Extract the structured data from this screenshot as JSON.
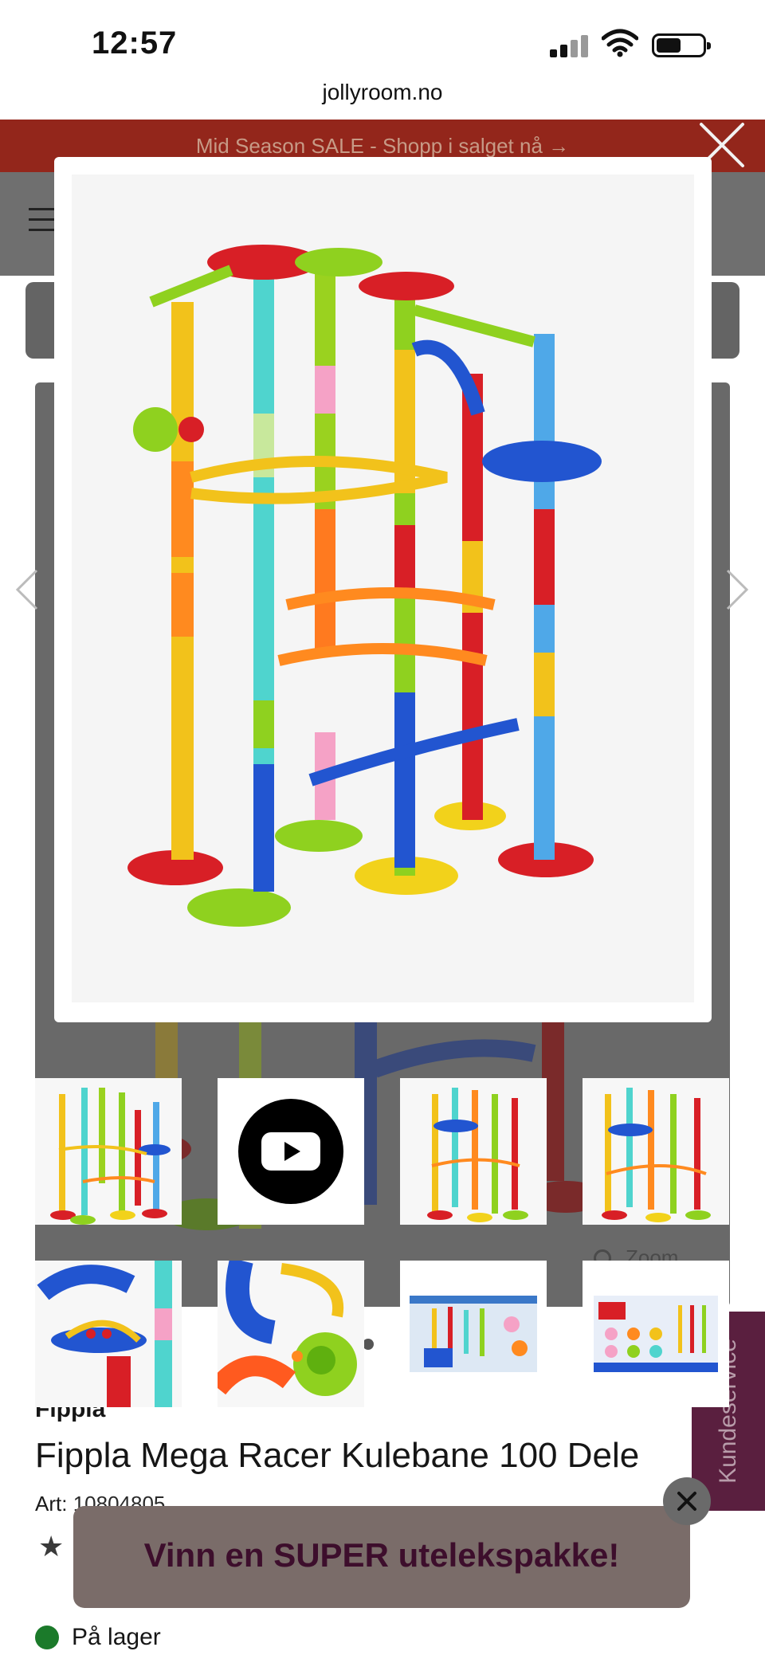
{
  "status_bar": {
    "time": "12:57"
  },
  "browser": {
    "url": "jollyroom.no"
  },
  "promo_banner": {
    "text": "Mid Season SALE - Shopp i salget nå →"
  },
  "gallery": {
    "zoom_label": "Zoom",
    "thumbnails": [
      {
        "kind": "product-image"
      },
      {
        "kind": "video",
        "icon": "youtube-play-icon"
      },
      {
        "kind": "product-image"
      },
      {
        "kind": "product-image"
      },
      {
        "kind": "detail-closeup"
      },
      {
        "kind": "detail-closeup"
      },
      {
        "kind": "box-front"
      },
      {
        "kind": "box-back"
      }
    ]
  },
  "product": {
    "brand": "Fippla",
    "title": "Fippla Mega Racer Kulebane 100 Dele",
    "art_label": "Art:",
    "art_number": "10804805",
    "stock_status": "På lager"
  },
  "customer_service": {
    "label": "Kundeservice"
  },
  "promo_popup": {
    "text": "Vinn en SUPER utelekspakke!"
  },
  "colors": {
    "promo_banner": "#93261b",
    "customer_service_tab": "#5a1f3f",
    "in_stock": "#1b7a2a",
    "popup_text": "#3d0e2c"
  }
}
